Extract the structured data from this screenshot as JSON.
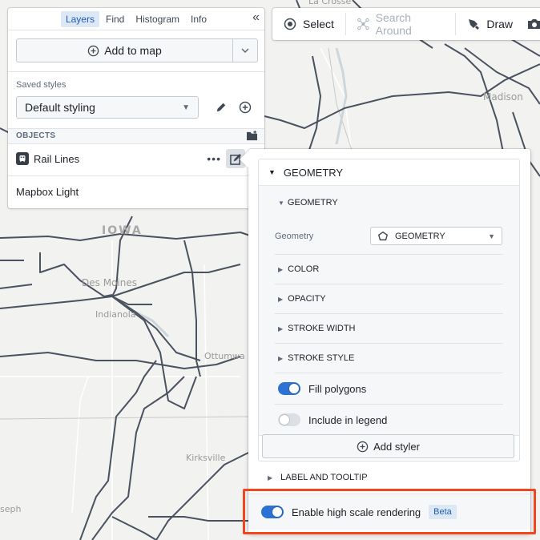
{
  "map": {
    "labels": {
      "state": "IOWA",
      "city1": "Des Moines",
      "city2": "Indianola",
      "city3": "Ottumwa",
      "city4": "Kirksville",
      "city5": "Madison",
      "city6": "La Crosse",
      "city7": "seph"
    },
    "rail_color": "#4a5260"
  },
  "left_panel": {
    "tabs": [
      {
        "label": "Layers",
        "active": true
      },
      {
        "label": "Find",
        "active": false
      },
      {
        "label": "Histogram",
        "active": false
      },
      {
        "label": "Info",
        "active": false
      }
    ],
    "collapse_icon": "double-chevron-left-icon",
    "add_to_map_label": "Add to map",
    "saved_styles_label": "Saved styles",
    "saved_style_value": "Default styling",
    "objects_header": "OBJECTS",
    "layers": [
      {
        "name": "Rail Lines",
        "icon": "train-icon"
      }
    ],
    "basemap": "Mapbox Light"
  },
  "toolbar": {
    "select_label": "Select",
    "search_around_label": "Search Around",
    "draw_label": "Draw"
  },
  "style_panel": {
    "card_title": "GEOMETRY",
    "subsection_title": "GEOMETRY",
    "geometry_field_label": "Geometry",
    "geometry_field_value": "GEOMETRY",
    "sections": [
      "COLOR",
      "OPACITY",
      "STROKE WIDTH",
      "STROKE STYLE"
    ],
    "fill_polygons_label": "Fill polygons",
    "fill_polygons_on": true,
    "include_legend_label": "Include in legend",
    "include_legend_on": false,
    "add_styler_label": "Add styler",
    "label_tooltip_title": "LABEL AND TOOLTIP",
    "high_scale_label": "Enable high scale rendering",
    "high_scale_on": true,
    "beta_badge": "Beta"
  },
  "colors": {
    "accent": "#2d72d2",
    "highlight": "#f2461f",
    "tab_active_bg": "#dde8f7"
  }
}
